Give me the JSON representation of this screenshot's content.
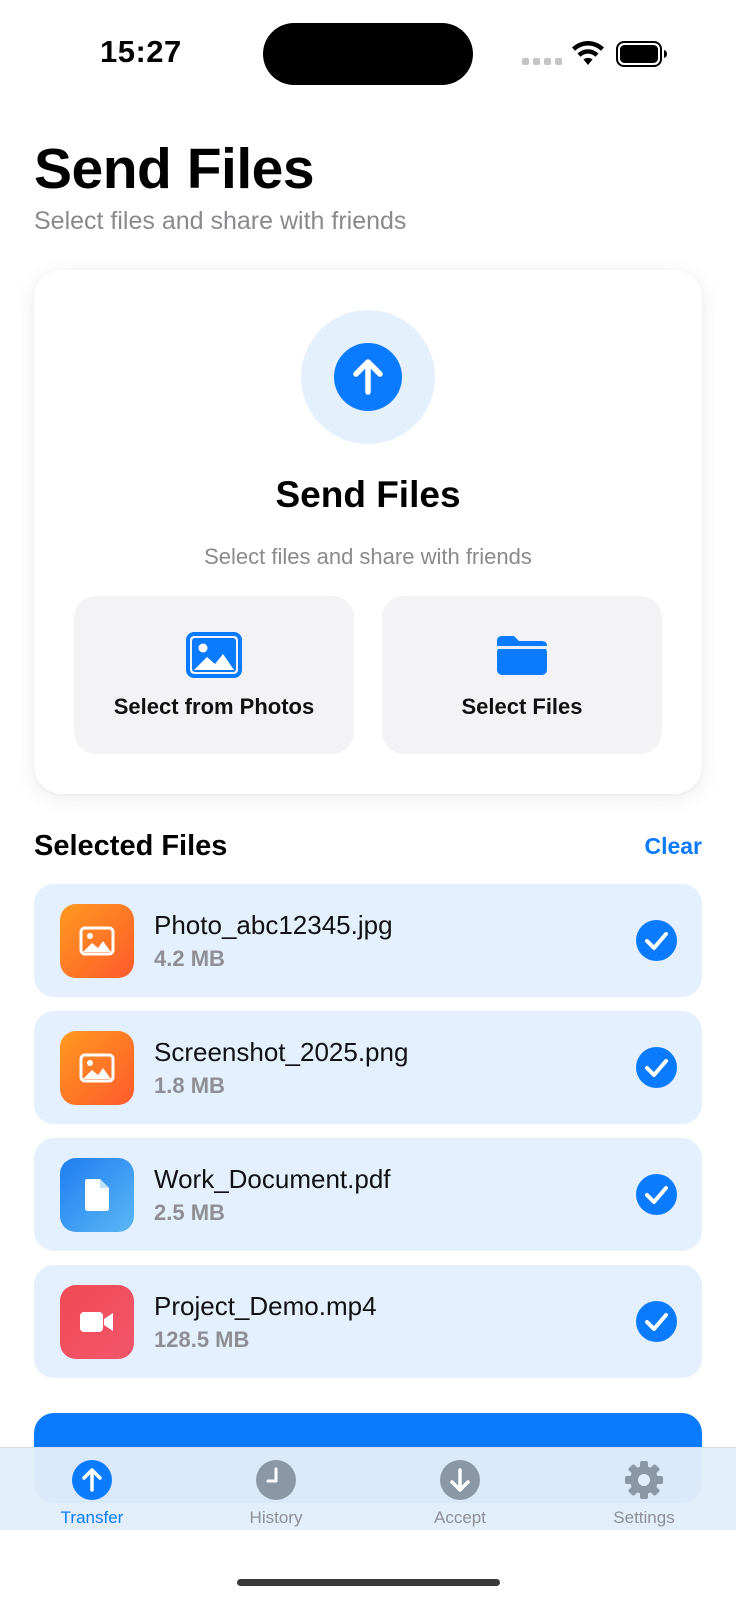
{
  "status_bar": {
    "time": "15:27"
  },
  "header": {
    "title": "Send Files",
    "subtitle": "Select files and share with friends"
  },
  "upload_card": {
    "title": "Send Files",
    "subtitle": "Select files and share with friends",
    "buttons": [
      {
        "label": "Select from Photos",
        "icon": "photo-icon"
      },
      {
        "label": "Select Files",
        "icon": "folder-icon"
      }
    ]
  },
  "selected": {
    "title": "Selected Files",
    "clear_label": "Clear",
    "files": [
      {
        "name": "Photo_abc12345.jpg",
        "size": "4.2 MB",
        "type": "image",
        "icon": "image-icon",
        "selected": true
      },
      {
        "name": "Screenshot_2025.png",
        "size": "1.8 MB",
        "type": "image",
        "icon": "image-icon",
        "selected": true
      },
      {
        "name": "Work_Document.pdf",
        "size": "2.5 MB",
        "type": "document",
        "icon": "document-icon",
        "selected": true
      },
      {
        "name": "Project_Demo.mp4",
        "size": "128.5 MB",
        "type": "video",
        "icon": "video-icon",
        "selected": true
      }
    ]
  },
  "tabs": [
    {
      "label": "Transfer",
      "icon": "arrow-up-circle-icon",
      "active": true
    },
    {
      "label": "History",
      "icon": "clock-icon",
      "active": false
    },
    {
      "label": "Accept",
      "icon": "arrow-down-circle-icon",
      "active": false
    },
    {
      "label": "Settings",
      "icon": "gear-icon",
      "active": false
    }
  ],
  "colors": {
    "accent": "#0a7aff",
    "image_gradient": [
      "#ff9a1f",
      "#ff5a2c"
    ],
    "document_gradient": [
      "#1e7cf2",
      "#5ab8f5"
    ],
    "video_gradient": [
      "#f04a55",
      "#f2566b"
    ],
    "row_background": "#e4f0fd"
  }
}
